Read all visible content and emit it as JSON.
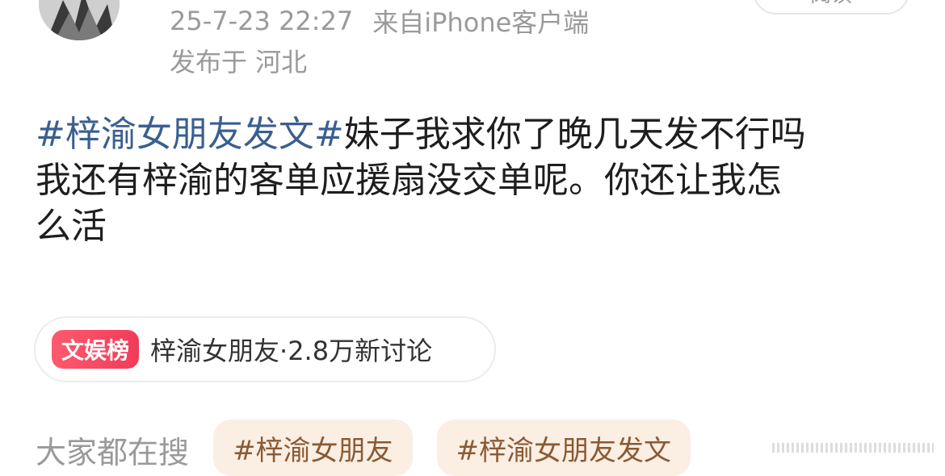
{
  "post": {
    "timestamp": "25-7-23 22:27",
    "source": "来自iPhone客户端",
    "location": "发布于 河北",
    "read_button": "阅读",
    "body": {
      "tag": "#梓渝女朋友发文#",
      "line1_rest": "妹子我求你了晚几天发不行吗",
      "line2": "我还有梓渝的客单应援扇没交单呢。你还让我怎",
      "line3": "么活"
    }
  },
  "hot_card": {
    "badge": "文娱榜",
    "text": "梓渝女朋友·2.8万新讨论"
  },
  "search": {
    "label": "大家都在搜",
    "chips": [
      "#梓渝女朋友",
      "#梓渝女朋友发文"
    ]
  },
  "colors": {
    "tag": "#3a5f8f",
    "meta": "#9a9a9a",
    "badge": "#f13b5a",
    "chip_bg": "#fbeee3"
  }
}
